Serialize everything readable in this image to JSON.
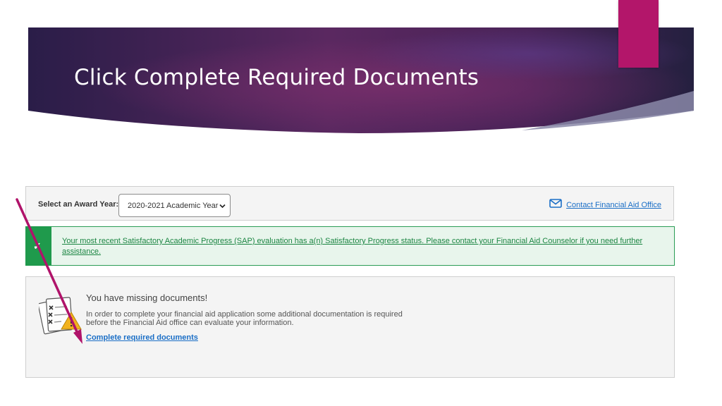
{
  "slide": {
    "title": "Click Complete Required Documents",
    "colors": {
      "banner_dark": "#2a1d48",
      "banner_mid": "#6b2d66",
      "accent": "#b3166a",
      "arrow": "#b0136a"
    }
  },
  "award_bar": {
    "label": "Select an Award Year:",
    "selected_year": "2020-2021 Academic Year",
    "contact_link": "Contact Financial Aid Office",
    "icons": {
      "select": "chevron-down-icon",
      "contact": "envelope-icon"
    }
  },
  "sap_alert": {
    "message": "Your most recent Satisfactory Academic Progress (SAP) evaluation has a(n) Satisfactory Progress status. Please contact your Financial Aid Counselor if you need further assistance.",
    "check_glyph": "✓",
    "color": "#1f9a4c"
  },
  "missing_docs": {
    "heading": "You have missing documents!",
    "description": "In order to complete your financial aid application some additional documentation is required before the Financial Aid office can evaluate your information.",
    "link": "Complete required documents",
    "icon": "document-warning-icon"
  }
}
